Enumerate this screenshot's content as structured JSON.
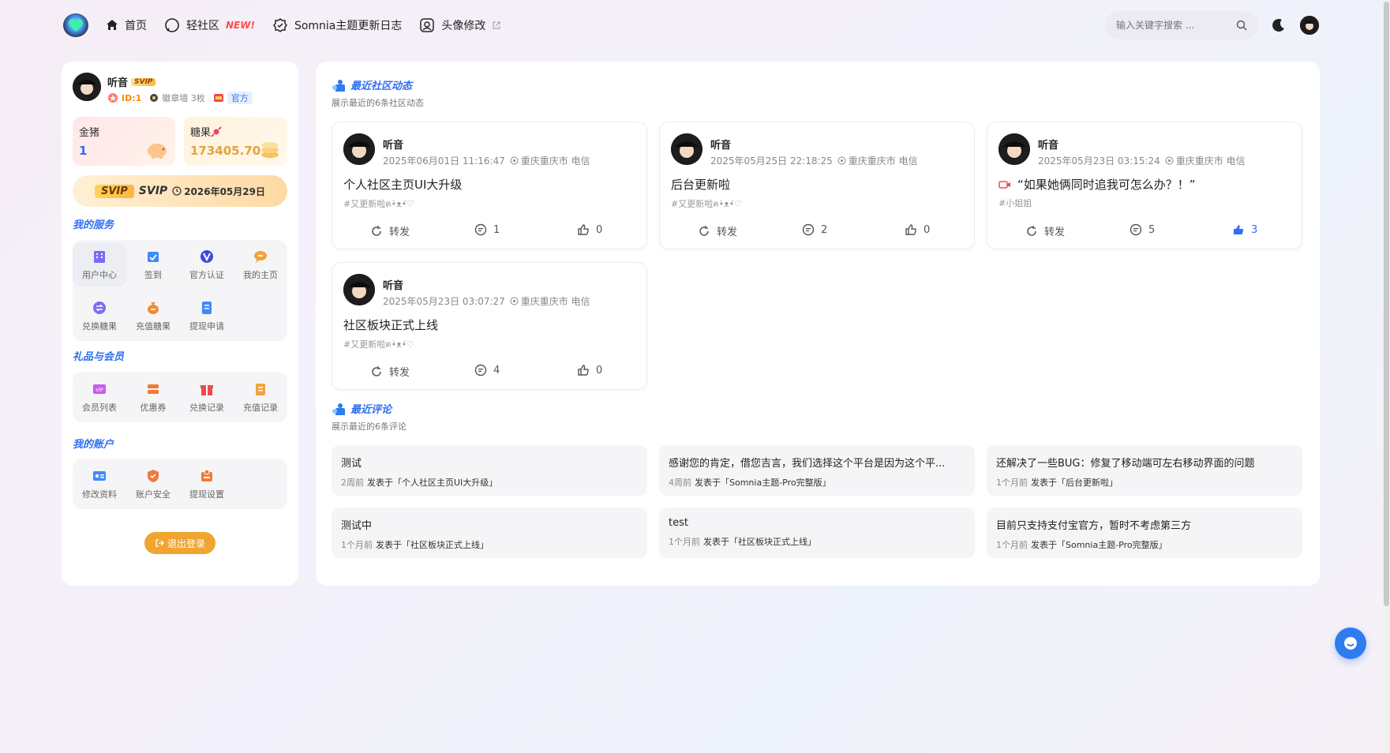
{
  "nav": {
    "items": [
      {
        "label": "首页",
        "icon": "home-icon"
      },
      {
        "label": "轻社区",
        "badge": "NEW!",
        "icon": "chat-icon"
      },
      {
        "label": "Somnia主题更新日志",
        "icon": "badge-icon"
      },
      {
        "label": "头像修改",
        "icon": "avatar-frame-icon"
      }
    ],
    "search_placeholder": "输入关键字搜索 ..."
  },
  "profile": {
    "name": "听音",
    "svip_tag": "SVIP",
    "uid": "ID:1",
    "badge_wall": "徽章墙 3枚",
    "official": "官方"
  },
  "wallet": {
    "pig_label": "金猪",
    "pig_value": "1",
    "candy_label": "糖果",
    "candy_value": "173405.70"
  },
  "svip": {
    "logo": "SVIP",
    "label": "SVIP",
    "expire": "2026年05月29日"
  },
  "sections": {
    "services": "我的服务",
    "gifts": "礼品与会员",
    "account": "我的账户"
  },
  "services": [
    {
      "label": "用户中心",
      "color": "#7b6cf6"
    },
    {
      "label": "签到",
      "color": "#3d8bfd"
    },
    {
      "label": "官方认证",
      "color": "#3a4bd8"
    },
    {
      "label": "我的主页",
      "color": "#f3a33a"
    },
    {
      "label": "兑换糖果",
      "color": "#7b6cf6"
    },
    {
      "label": "充值糖果",
      "color": "#f08a3a"
    },
    {
      "label": "提现申请",
      "color": "#3d8bfd"
    }
  ],
  "gifts": [
    {
      "label": "会员列表",
      "color": "#c85cf0"
    },
    {
      "label": "优惠券",
      "color": "#f07a3a"
    },
    {
      "label": "兑换记录",
      "color": "#f04a4a"
    },
    {
      "label": "充值记录",
      "color": "#f3a33a"
    }
  ],
  "account": [
    {
      "label": "修改资料",
      "color": "#3d8bfd"
    },
    {
      "label": "账户安全",
      "color": "#f07a3a"
    },
    {
      "label": "提现设置",
      "color": "#f07a3a"
    }
  ],
  "logout_label": "退出登录",
  "activity": {
    "title": "最近社区动态",
    "subtitle": "展示最近的6条社区动态",
    "posts": [
      {
        "author": "听音",
        "time": "2025年06月01日 11:16:47",
        "location": "重庆重庆市 电信",
        "title": "个人社区主页UI大升级",
        "tag": "#又更新啦ฅ•̀ᴥ•́♡",
        "share": "转发",
        "comments": "1",
        "likes": "0",
        "liked": false,
        "video": false
      },
      {
        "author": "听音",
        "time": "2025年05月25日 22:18:25",
        "location": "重庆重庆市 电信",
        "title": "后台更新啦",
        "tag": "#又更新啦ฅ•̀ᴥ•́♡",
        "share": "转发",
        "comments": "2",
        "likes": "0",
        "liked": false,
        "video": false
      },
      {
        "author": "听音",
        "time": "2025年05月23日 03:15:24",
        "location": "重庆重庆市 电信",
        "title": "“如果她俩同时追我可怎么办？！”",
        "tag": "#小姐姐",
        "share": "转发",
        "comments": "5",
        "likes": "3",
        "liked": true,
        "video": true
      },
      {
        "author": "听音",
        "time": "2025年05月23日 03:07:27",
        "location": "重庆重庆市 电信",
        "title": "社区板块正式上线",
        "tag": "#又更新啦ฅ•̀ᴥ•́♡",
        "share": "转发",
        "comments": "4",
        "likes": "0",
        "liked": false,
        "video": false
      }
    ]
  },
  "comments": {
    "title": "最近评论",
    "subtitle": "展示最近的6条评论",
    "items": [
      {
        "text": "测试",
        "ago": "2周前",
        "on": "发表于「个人社区主页UI大升级」"
      },
      {
        "text": "感谢您的肯定，借您吉言，我们选择这个平台是因为这个平...",
        "ago": "4周前",
        "on": "发表于「Somnia主题-Pro完整版」"
      },
      {
        "text": "还解决了一些BUG：修复了移动端可左右移动界面的问题",
        "ago": "1个月前",
        "on": "发表于「后台更新啦」"
      },
      {
        "text": "测试中",
        "ago": "1个月前",
        "on": "发表于「社区板块正式上线」"
      },
      {
        "text": "test",
        "ago": "1个月前",
        "on": "发表于「社区板块正式上线」"
      },
      {
        "text": "目前只支持支付宝官方，暂时不考虑第三方",
        "ago": "1个月前",
        "on": "发表于「Somnia主题-Pro完整版」"
      }
    ]
  }
}
